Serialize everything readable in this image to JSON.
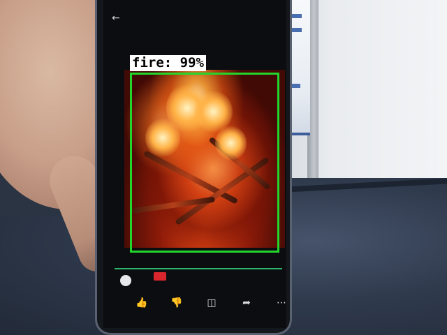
{
  "detection": {
    "class": "fire",
    "confidence_text": "99%",
    "box_color": "#22d62b",
    "label_background": "#ffffff"
  },
  "phone_ui": {
    "back_icon": "arrow-left-icon",
    "icons": [
      "like-icon",
      "dislike-icon",
      "comment-icon",
      "share-icon",
      "more-icon"
    ]
  }
}
